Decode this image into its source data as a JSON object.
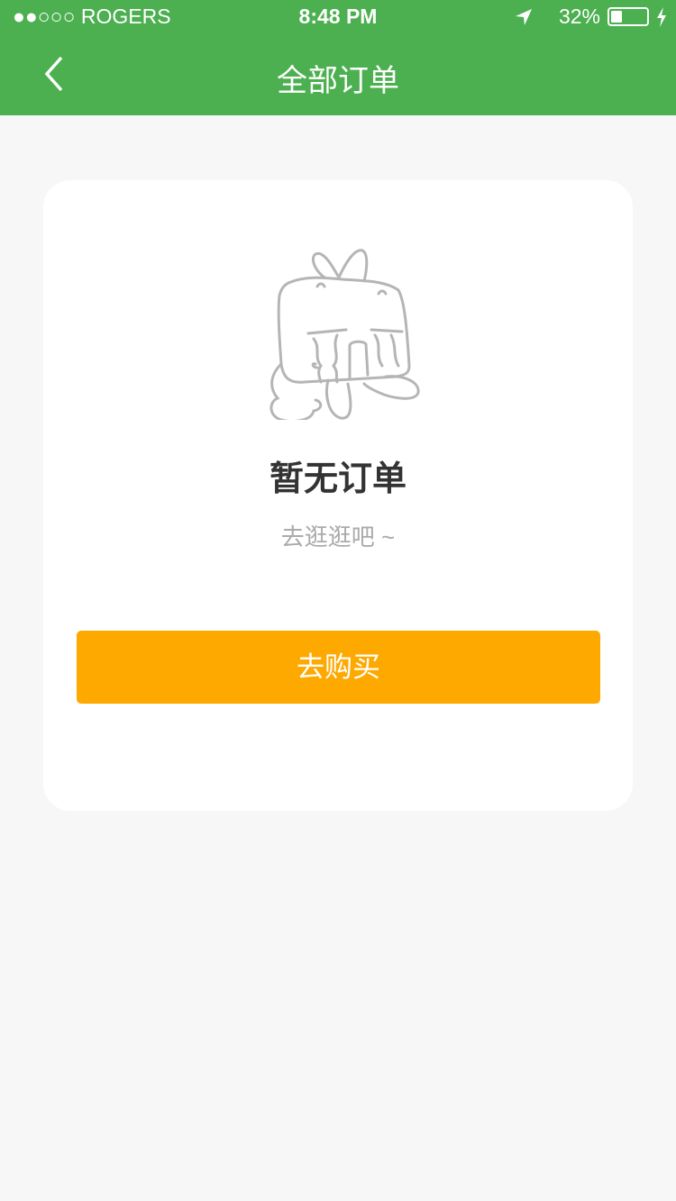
{
  "status_bar": {
    "carrier": "●●○○○ ROGERS",
    "time": "8:48 PM",
    "battery": "32%",
    "battery_level": 0.32
  },
  "nav": {
    "title": "全部订单",
    "back_icon": "chevron-left-icon"
  },
  "empty_state": {
    "illustration": "crying-bunny",
    "heading": "暂无订单",
    "subtext": "去逛逛吧 ~",
    "button_label": "去购买"
  },
  "colors": {
    "header": "#4caf50",
    "button": "#fea900"
  }
}
